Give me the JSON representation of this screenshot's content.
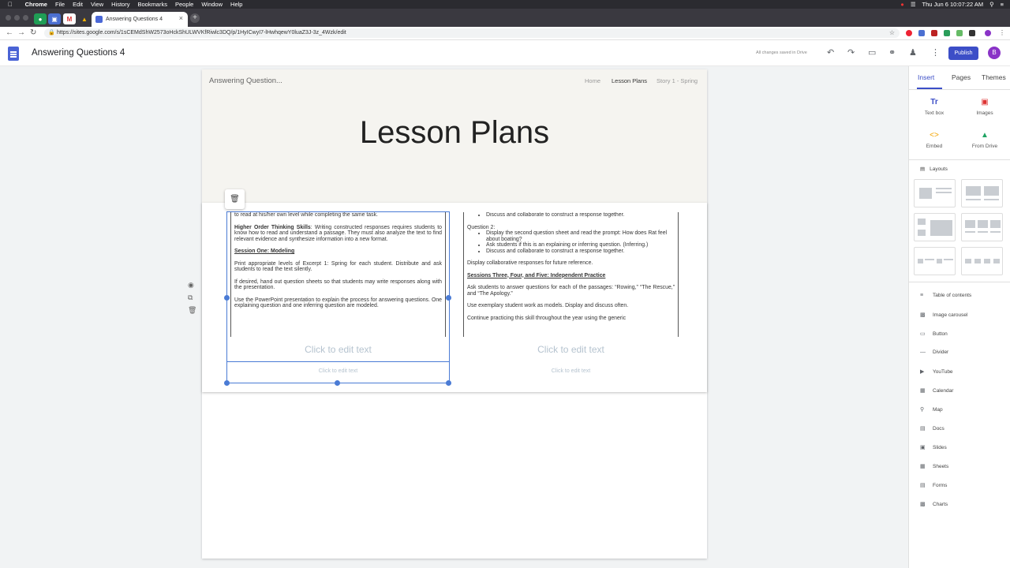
{
  "mac_menu": {
    "apple": "",
    "items": [
      "Chrome",
      "File",
      "Edit",
      "View",
      "History",
      "Bookmarks",
      "People",
      "Window",
      "Help"
    ],
    "clock": "Thu Jun 6  10:07:22 AM"
  },
  "browser": {
    "tab_title": "Answering Questions 4",
    "url": "https://sites.google.com/s/1sCEMdShW2573oHckShULWVKfRiwlc3DQ/p/1HyICwyI7-lHwhqewY0luaZ3J-3z_4Wzk/edit"
  },
  "app": {
    "title": "Answering Questions 4",
    "saved_status": "All changes saved in Drive",
    "publish_label": "Publish",
    "avatar_letter": "B"
  },
  "site": {
    "name": "Answering Question...",
    "nav": [
      "Home",
      "Lesson Plans",
      "Story 1 - Spring"
    ],
    "page_title": "Lesson Plans"
  },
  "left_embed": {
    "line1": "to read at his/her own level while completing the same task.",
    "p2_bold": "Higher Order Thinking Skills",
    "p2": ": Writing constructed responses requires students to know how to read and understand a passage. They must also analyze the text to find relevant evidence and synthesize information into a new format.",
    "h_session": "Session One: Modeling",
    "p3": "Print appropriate levels of Excerpt 1: Spring for each student. Distribute and ask students to read the text silently.",
    "p4": "If desired, hand out question sheets so that students may write responses along with the presentation.",
    "p5": "Use the PowerPoint presentation to explain the process for answering questions. One explaining question and one inferring question are modeled."
  },
  "right_embed": {
    "b0": "Discuss and collaborate to construct a response together.",
    "q2": "Question 2:",
    "b1": "Display the second question sheet and read the prompt: How does Rat feel about boating?",
    "b2": "Ask students if this is an explaining or inferring question. (Inferring.)",
    "b3": "Discuss and collaborate to construct a response together.",
    "p1": "Display collaborative responses for future reference.",
    "h_sessions": "Sessions Three, Four, and Five: Independent Practice",
    "p2": "Ask students to answer questions for each of the passages: “Rowing,” “The Rescue,” and “The Apology.”",
    "p3": "Use exemplary student work as models. Display and discuss often.",
    "p4": "Continue practicing this skill throughout the year using the generic"
  },
  "placeholders": {
    "click_edit_big": "Click to edit text",
    "click_edit_small": "Click to edit text"
  },
  "panel": {
    "tabs": [
      "Insert",
      "Pages",
      "Themes"
    ],
    "buttons": [
      "Text box",
      "Images",
      "Embed",
      "From Drive"
    ],
    "layouts_label": "Layouts",
    "items": [
      "Table of contents",
      "Image carousel",
      "Button",
      "Divider",
      "YouTube",
      "Calendar",
      "Map",
      "Docs",
      "Slides",
      "Sheets",
      "Forms",
      "Charts"
    ]
  },
  "colors": {
    "accent": "#3c4ec7",
    "selection": "#4a7bd5",
    "banner": "#f5f4f0"
  }
}
